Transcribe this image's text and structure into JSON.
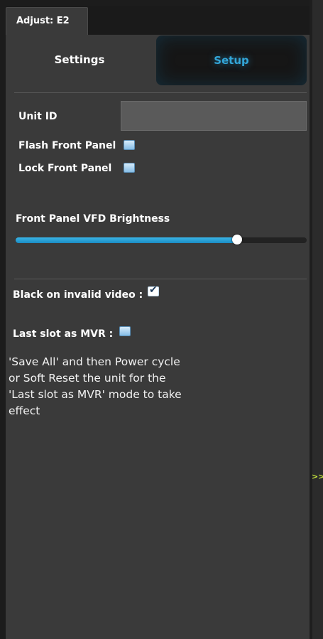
{
  "panel": {
    "title_tab": "Adjust: E2",
    "segments": [
      {
        "label": "Settings",
        "active": true
      },
      {
        "label": "Setup",
        "active": false
      }
    ]
  },
  "form": {
    "unit_id_label": "Unit ID",
    "unit_id_value": "",
    "flash_front_panel_label": "Flash Front Panel",
    "flash_front_panel_checked": false,
    "lock_front_panel_label": "Lock Front Panel",
    "lock_front_panel_checked": false,
    "brightness_label": "Front Panel VFD Brightness",
    "brightness_fraction": 0.76,
    "black_invalid_label": "Black on invalid video :",
    "black_invalid_checked": true,
    "last_slot_mvr_label": "Last slot as MVR :",
    "last_slot_mvr_checked": false,
    "note": "'Save All' and then Power cycle\n or Soft Reset the unit for the\n'Last slot as MVR' mode to take\neffect"
  },
  "side": {
    "expand_label": ">>"
  },
  "colors": {
    "accent": "#33a6d8",
    "panel_bg": "#3a3a3a",
    "checkbox": "#a8d2f2"
  },
  "icons": {
    "checked": "check-icon",
    "expand": "double-chevron-right-icon"
  }
}
